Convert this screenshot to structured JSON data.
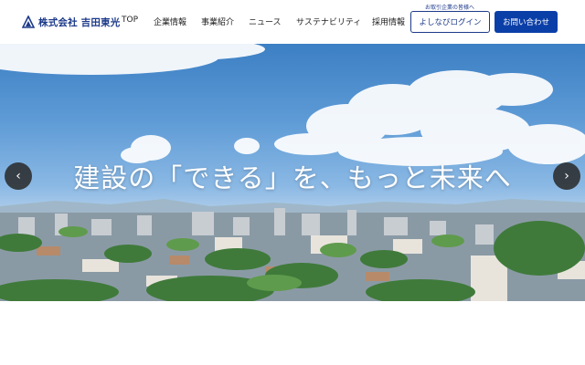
{
  "header": {
    "logo_text": "株式会社 吉田東光",
    "nav": [
      {
        "label": "TOP"
      },
      {
        "label": "企業情報"
      },
      {
        "label": "事業紹介"
      },
      {
        "label": "ニュース"
      },
      {
        "label": "サステナビリティ"
      },
      {
        "label": "採用情報"
      }
    ],
    "login_note": "お取引企業の皆様へ",
    "login_button": "よしなびログイン",
    "contact_button": "お問い合わせ"
  },
  "hero": {
    "headline": "建設の「できる」を、もっと未来へ",
    "prev_icon": "chevron-left-icon",
    "next_icon": "chevron-right-icon",
    "prev_glyph": "‹",
    "next_glyph": "›"
  },
  "colors": {
    "brand": "#1d3a8a",
    "primary_button": "#0b3fa8",
    "sky": "#5e9bd6"
  }
}
